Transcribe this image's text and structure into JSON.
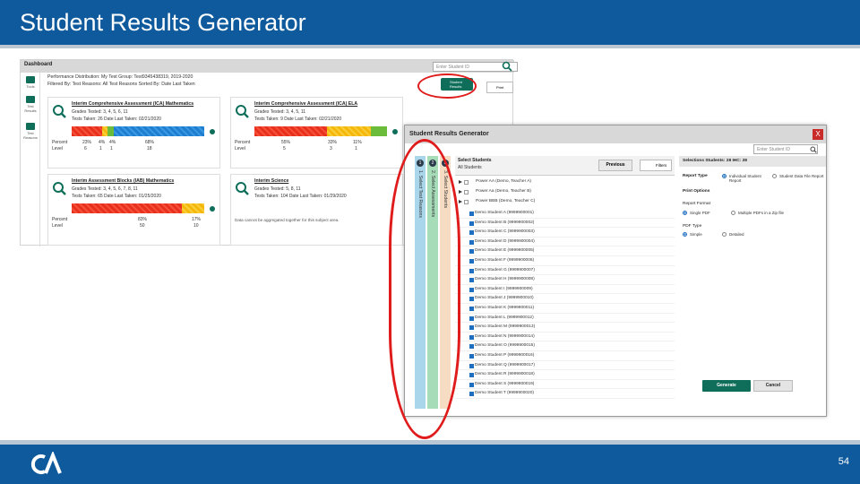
{
  "slide": {
    "title": "Student Results Generator",
    "page_number": "54"
  },
  "dashboard": {
    "header": "Dashboard",
    "search_placeholder": "Enter Student ID",
    "side_tools": [
      "Tools",
      "Test Results",
      "Test Reasons"
    ],
    "info_lines": [
      "Performance Distribution: My Test Group: Test9345438319, 2019-2020",
      "Filtered By: Test Reasons: All Test Reasons   Sorted By: Date Last Taken"
    ],
    "ssr_button": "Student Results",
    "print_button": "Print",
    "cards": [
      {
        "title": "Interim Comprehensive Assessment (ICA) Mathematics",
        "grades": "Grades Tested: 3, 4, 5, 6, 11",
        "tests": "Tests Taken: 26     Date Last Taken: 02/21/2020",
        "percents": [
          "23%",
          "4%",
          "4%",
          "68%"
        ],
        "levels": [
          "6",
          "1",
          "1",
          "18"
        ]
      },
      {
        "title": "Interim Comprehensive Assessment (ICA) ELA",
        "grades": "Grades Tested: 3, 4, 5, 11",
        "tests": "Tests Taken: 9     Date Last Taken: 02/21/2020",
        "percents": [
          "55%",
          "33%",
          "11%"
        ],
        "levels": [
          "5",
          "3",
          "1"
        ]
      },
      {
        "title": "Interim Assessment Blocks (IAB) Mathematics",
        "grades": "Grades Tested: 3, 4, 5, 6, 7, 8, 11",
        "tests": "Tests Taken: 65     Date Last Taken: 01/25/2020",
        "percents": [
          "83%",
          "17%"
        ],
        "levels": [
          "50",
          "10"
        ]
      },
      {
        "title": "Interim Science",
        "grades": "Grades Tested: 5, 8, 11",
        "tests": "Tests Taken: 104     Date Last Taken: 01/29/2020",
        "note": "Data cannot be aggregated together for this subject area."
      }
    ],
    "row_labels": {
      "percent": "Percent",
      "level": "Level"
    }
  },
  "dialog": {
    "title": "Student Results Generator",
    "close_label": "X",
    "search_placeholder": "Enter Student ID",
    "tabs": [
      {
        "num": "1",
        "label": "1. Select Test Reasons"
      },
      {
        "num": "2",
        "label": "2. Select Assessments"
      },
      {
        "num": "3",
        "label": "3. Select Students"
      }
    ],
    "students_header": "Select Students",
    "all_students": "All Students",
    "previous_label": "Previous",
    "filters_label": "Filters",
    "groups": [
      "Power AA (Demo, Teacher A)",
      "Power Aa (Demo, Teacher B)",
      "Power BBB (Demo, Teacher C)"
    ],
    "students": [
      "Demo Student A (9999900001)",
      "Demo Student B (9999900002)",
      "Demo Student C (9999900003)",
      "Demo Student D (9999900004)",
      "Demo Student E (9999900005)",
      "Demo Student F (9999900006)",
      "Demo Student G (9999900007)",
      "Demo Student H (9999900008)",
      "Demo Student I (9999900009)",
      "Demo Student J (9999900010)",
      "Demo Student K (9999900011)",
      "Demo Student L (9999900012)",
      "Demo Student M (9999900013)",
      "Demo Student N (9999900014)",
      "Demo Student O (9999900015)",
      "Demo Student P (9999900016)",
      "Demo Student Q (9999900017)",
      "Demo Student R (9999900018)",
      "Demo Student S (9999900019)",
      "Demo Student T (9999900020)"
    ],
    "selections_bar": "Selections   Students: 28   IHC: 28",
    "report_type_label": "Report Type",
    "report_type_opts": [
      "Individual Student Report",
      "Student Data File Report"
    ],
    "print_options_label": "Print Options",
    "report_format_label": "Report Format",
    "report_format_opts": [
      "Single PDF",
      "Multiple PDFs in a Zip file"
    ],
    "pdf_type_label": "PDF Type",
    "pdf_type_opts": [
      "Simple",
      "Detailed"
    ],
    "generate_label": "Generate",
    "cancel_label": "Cancel"
  },
  "colors": {
    "header_blue": "#0e5a9c",
    "accent_green": "#0e6e5a",
    "annotation_red": "#e01b1b"
  }
}
